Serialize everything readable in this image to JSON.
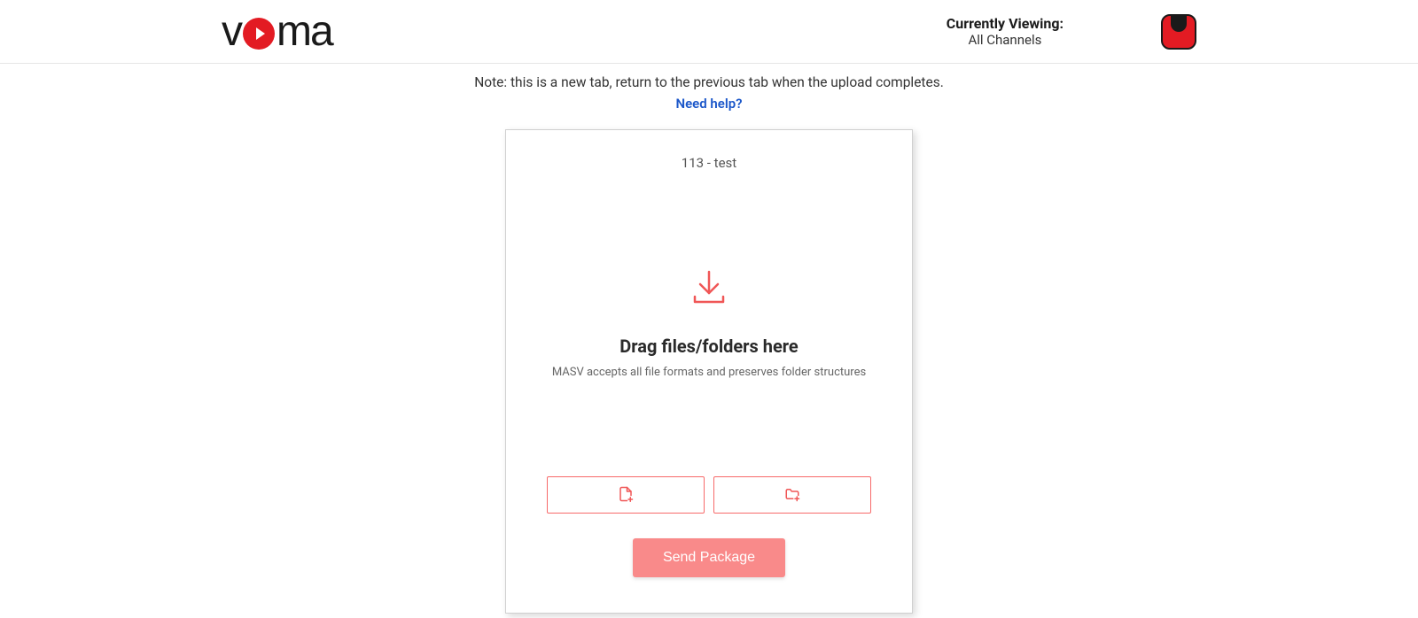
{
  "header": {
    "logo_text_before": "v",
    "logo_text_after": "ma",
    "viewing_label": "Currently Viewing:",
    "viewing_value": "All Channels"
  },
  "main": {
    "note": "Note: this is a new tab, return to the previous tab when the upload completes.",
    "help_link": "Need help?",
    "upload": {
      "package_title": "113 - test",
      "drag_heading": "Drag files/folders here",
      "drag_sub": "MASV accepts all file formats and preserves folder structures",
      "send_label": "Send Package"
    }
  }
}
